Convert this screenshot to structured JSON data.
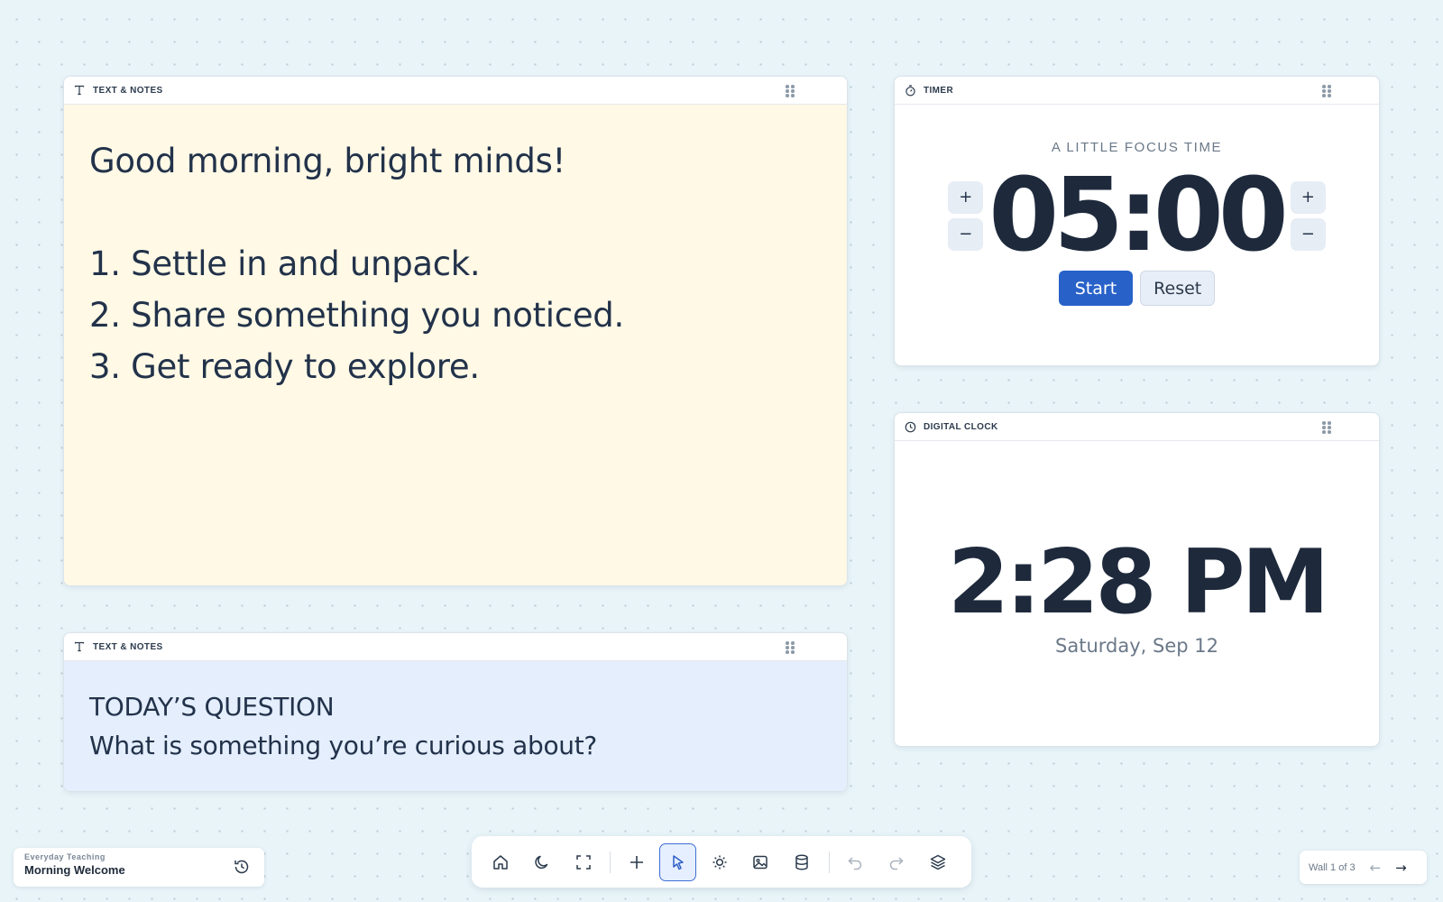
{
  "notes_widget_1": {
    "header_title": "TEXT & NOTES",
    "header_icon": "text-icon",
    "background_color": "#fff9e6",
    "lines": [
      "Good morning, bright minds!",
      "",
      "1. Settle in and unpack.",
      "2. Share something you noticed.",
      "3. Get ready to explore."
    ]
  },
  "notes_widget_2": {
    "header_title": "TEXT & NOTES",
    "header_icon": "text-icon",
    "background_color": "#e4eefd",
    "title": "TODAY’S QUESTION",
    "question": "What is something you’re curious about?"
  },
  "timer_widget": {
    "header_title": "TIMER",
    "header_icon": "timer-icon",
    "caption": "A LITTLE FOCUS TIME",
    "display": "05:00",
    "increment_label": "+",
    "decrement_label": "−",
    "start_label": "Start",
    "reset_label": "Reset",
    "accent_color": "#2862c9"
  },
  "clock_widget": {
    "header_title": "DIGITAL CLOCK",
    "header_icon": "clock-icon",
    "time": "2:28 PM",
    "date": "Saturday, Sep 12"
  },
  "board": {
    "workspace": "Everyday Teaching",
    "name": "Morning Welcome",
    "history_icon": "history-icon"
  },
  "toolbar": {
    "tools": [
      "home-icon",
      "moon-icon",
      "fullscreen-icon",
      "plus-icon",
      "pointer-icon",
      "brightness-icon",
      "image-icon",
      "database-icon",
      "undo-icon",
      "redo-icon",
      "layers-icon"
    ],
    "active_tool": "pointer-icon"
  },
  "pager": {
    "label": "Wall 1 of 3",
    "prev": "←",
    "next": "→"
  }
}
